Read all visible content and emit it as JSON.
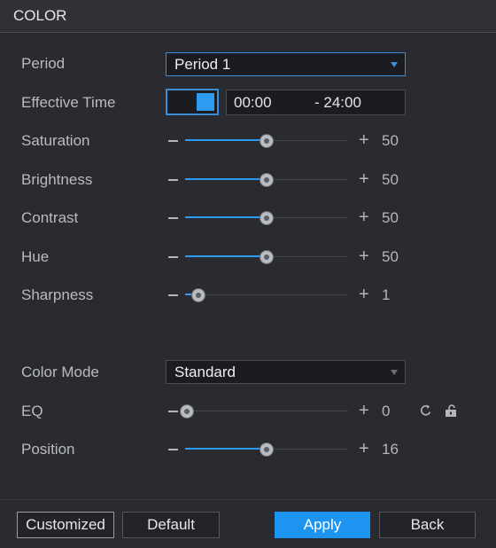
{
  "window": {
    "title": "COLOR"
  },
  "period": {
    "label": "Period",
    "value": "Period 1"
  },
  "effective_time": {
    "label": "Effective Time",
    "enabled": true,
    "start": "00:00",
    "end": "- 24:00"
  },
  "sliders": [
    {
      "label": "Saturation",
      "value": "50",
      "percent": 50
    },
    {
      "label": "Brightness",
      "value": "50",
      "percent": 50
    },
    {
      "label": "Contrast",
      "value": "50",
      "percent": 50
    },
    {
      "label": "Hue",
      "value": "50",
      "percent": 50
    },
    {
      "label": "Sharpness",
      "value": "1",
      "percent": 8
    }
  ],
  "color_mode": {
    "label": "Color Mode",
    "value": "Standard"
  },
  "eq": {
    "label": "EQ",
    "value": "0",
    "percent": 1
  },
  "position": {
    "label": "Position",
    "value": "16",
    "percent": 50
  },
  "icons": {
    "reset": "reset-icon",
    "lock": "lock-icon"
  },
  "buttons": {
    "customized": "Customized",
    "default": "Default",
    "apply": "Apply",
    "back": "Back"
  },
  "colors": {
    "accent": "#2f9bf0",
    "apply_bg": "#1d95f0",
    "background": "#292b30"
  }
}
